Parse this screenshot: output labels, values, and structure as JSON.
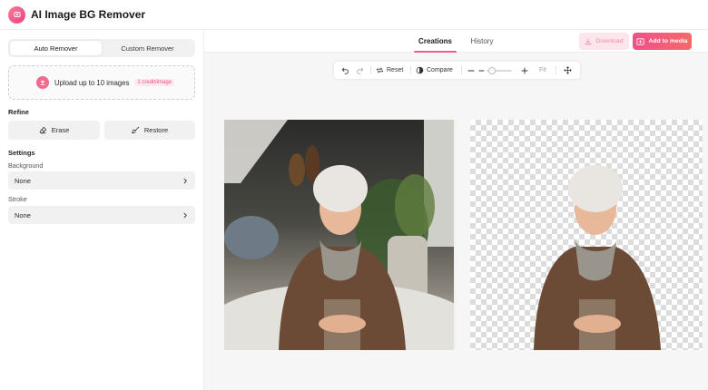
{
  "app": {
    "title": "AI Image BG Remover"
  },
  "sidebar": {
    "mode_tabs": [
      "Auto Remover",
      "Custom Remover"
    ],
    "upload": {
      "label": "Upload up to 10 images",
      "badge": "1 credit/image"
    },
    "refine": {
      "title": "Refine",
      "erase_label": "Erase",
      "restore_label": "Restore"
    },
    "settings": {
      "title": "Settings",
      "background": {
        "label": "Background",
        "value": "None"
      },
      "stroke": {
        "label": "Stroke",
        "value": "None"
      }
    }
  },
  "main": {
    "tabs": [
      "Creations",
      "History"
    ],
    "download_label": "Download",
    "add_media_label": "Add to media",
    "toolbar": {
      "reset_label": "Reset",
      "compare_label": "Compare",
      "fit_label": "Fit",
      "zoom_level": 0.2
    }
  },
  "colors": {
    "accent": "#ee5d85",
    "accent_light": "#fde5ec"
  },
  "icons": [
    "logo-icon",
    "upload-icon",
    "eraser-icon",
    "brush-icon",
    "chevron-right-icon",
    "download-icon",
    "add-media-icon",
    "undo-icon",
    "redo-icon",
    "reset-icon",
    "compare-icon",
    "minus-icon",
    "plus-icon",
    "move-icon"
  ]
}
